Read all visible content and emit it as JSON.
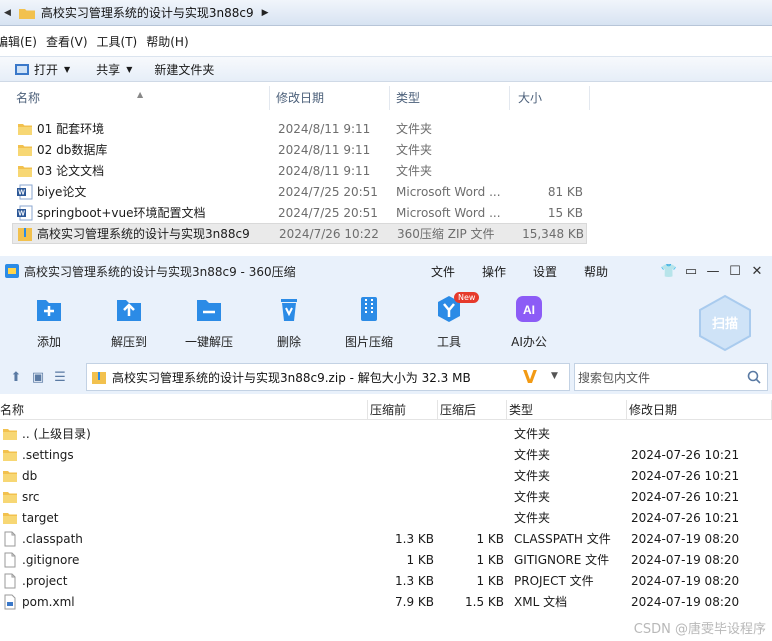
{
  "explorer": {
    "path": "高校实习管理系统的设计与实现3n88c9",
    "menu": [
      "编辑(E)",
      "查看(V)",
      "工具(T)",
      "帮助(H)"
    ],
    "commands": {
      "open": "打开",
      "share": "共享",
      "new_folder": "新建文件夹"
    },
    "columns": {
      "name": "名称",
      "date": "修改日期",
      "type": "类型",
      "size": "大小"
    },
    "rows": [
      {
        "name": "01 配套环境",
        "date": "2024/8/11 9:11",
        "type": "文件夹",
        "size": "",
        "icon": "folder-icon"
      },
      {
        "name": "02 db数据库",
        "date": "2024/8/11 9:11",
        "type": "文件夹",
        "size": "",
        "icon": "folder-icon"
      },
      {
        "name": "03 论文文档",
        "date": "2024/8/11 9:11",
        "type": "文件夹",
        "size": "",
        "icon": "folder-icon"
      },
      {
        "name": "biye论文",
        "date": "2024/7/25 20:51",
        "type": "Microsoft Word ...",
        "size": "81 KB",
        "icon": "word-icon"
      },
      {
        "name": "springboot+vue环境配置文档",
        "date": "2024/7/25 20:51",
        "type": "Microsoft Word ...",
        "size": "15 KB",
        "icon": "word-icon"
      },
      {
        "name": "高校实习管理系统的设计与实现3n88c9",
        "date": "2024/7/26 10:22",
        "type": "360压缩 ZIP 文件",
        "size": "15,348 KB",
        "icon": "zip-icon"
      }
    ]
  },
  "zip": {
    "title": "高校实习管理系统的设计与实现3n88c9 - 360压缩",
    "menu": [
      "文件",
      "操作",
      "设置",
      "帮助"
    ],
    "tools": [
      {
        "label": "添加",
        "icon": "add-icon"
      },
      {
        "label": "解压到",
        "icon": "extract-to-icon"
      },
      {
        "label": "一键解压",
        "icon": "one-click-extract-icon"
      },
      {
        "label": "删除",
        "icon": "delete-icon"
      },
      {
        "label": "图片压缩",
        "icon": "image-compress-icon"
      },
      {
        "label": "工具",
        "icon": "tools-icon"
      },
      {
        "label": "AI办公",
        "icon": "ai-office-icon"
      }
    ],
    "new_badge": "New",
    "scan_label": "扫描",
    "ai_text": "AI",
    "address": "高校实习管理系统的设计与实现3n88c9.zip - 解包大小为 32.3 MB",
    "search_placeholder": "搜索包内文件",
    "columns": {
      "name": "名称",
      "before": "压缩前",
      "after": "压缩后",
      "type": "类型",
      "date": "修改日期"
    },
    "rows": [
      {
        "name": ".. (上级目录)",
        "before": "",
        "after": "",
        "type": "文件夹",
        "date": "",
        "icon": "folder-icon"
      },
      {
        "name": ".settings",
        "before": "",
        "after": "",
        "type": "文件夹",
        "date": "2024-07-26 10:21",
        "icon": "folder-icon"
      },
      {
        "name": "db",
        "before": "",
        "after": "",
        "type": "文件夹",
        "date": "2024-07-26 10:21",
        "icon": "folder-icon"
      },
      {
        "name": "src",
        "before": "",
        "after": "",
        "type": "文件夹",
        "date": "2024-07-26 10:21",
        "icon": "folder-icon"
      },
      {
        "name": "target",
        "before": "",
        "after": "",
        "type": "文件夹",
        "date": "2024-07-26 10:21",
        "icon": "folder-icon"
      },
      {
        "name": ".classpath",
        "before": "1.3 KB",
        "after": "1 KB",
        "type": "CLASSPATH 文件",
        "date": "2024-07-19 08:20",
        "icon": "file-icon"
      },
      {
        "name": ".gitignore",
        "before": "1 KB",
        "after": "1 KB",
        "type": "GITIGNORE 文件",
        "date": "2024-07-19 08:20",
        "icon": "file-icon"
      },
      {
        "name": ".project",
        "before": "1.3 KB",
        "after": "1 KB",
        "type": "PROJECT 文件",
        "date": "2024-07-19 08:20",
        "icon": "file-icon"
      },
      {
        "name": "pom.xml",
        "before": "7.9 KB",
        "after": "1.5 KB",
        "type": "XML 文档",
        "date": "2024-07-19 08:20",
        "icon": "xml-file-icon"
      }
    ]
  },
  "watermark": "CSDN @唐雯毕设程序",
  "colors": {
    "accent": "#2b8be6",
    "folder": "#f2c14e",
    "zip_bg": "#e9f1fb"
  }
}
